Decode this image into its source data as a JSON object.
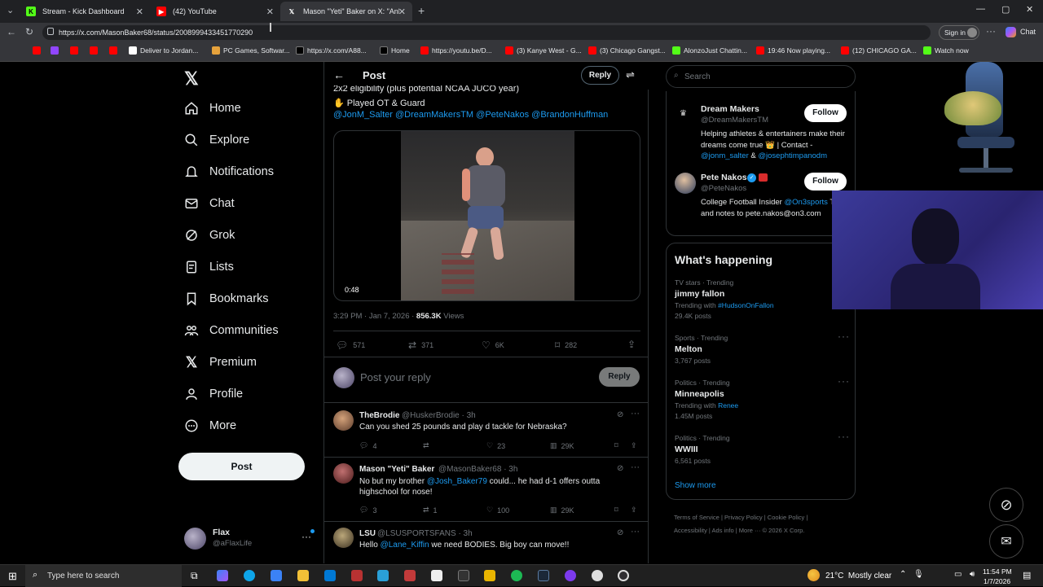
{
  "browser": {
    "tabs": [
      {
        "label": "Stream - Kick Dashboard",
        "fav": "K"
      },
      {
        "label": "(42) YouTube",
        "fav": "▶"
      },
      {
        "label": "Mason \"Yeti\" Baker on X: \"Ankle b",
        "fav": "X"
      }
    ],
    "url": "https://x.com/MasonBaker68/status/2008999433451770290",
    "sign_in": "Sign in",
    "chat": "Chat",
    "bookmarks": [
      "Deliver to Jordan...",
      "PC Games, Softwar...",
      "https://x.com/A88...",
      "Home",
      "https://youtu.be/D...",
      "(3) Kanye West - G...",
      "(3) Chicago Gangst...",
      "AlonzoJust Chattin...",
      "19:46 Now playing...",
      "(12) CHICAGO GA...",
      "Watch now"
    ]
  },
  "nav": {
    "items": [
      "Home",
      "Explore",
      "Notifications",
      "Chat",
      "Grok",
      "Lists",
      "Bookmarks",
      "Communities",
      "Premium",
      "Profile",
      "More"
    ],
    "post_button": "Post",
    "account_name": "Flax",
    "account_handle": "@aFlaxLife"
  },
  "post": {
    "header": "Post",
    "reply_button": "Reply",
    "line_partial": "2x2 eligibility (plus potential NCAA JUCO year)",
    "line_ot": "Played OT & Guard",
    "mentions": "@JonM_Salter @DreamMakersTM @PeteNakos @BrandonHuffman",
    "video_duration": "0:48",
    "timestamp": "3:29 PM · Jan 7, 2026 · ",
    "views_count": "856.3K",
    "views_label": " Views",
    "replies": "571",
    "reposts": "371",
    "likes": "6K",
    "bookmarks": "282",
    "reply_placeholder": "Post your reply",
    "reply_submit": "Reply"
  },
  "replies": [
    {
      "name": "TheBrodie",
      "handle": "@HuskerBrodie · 3h",
      "text": "Can you shed 25 pounds and play d tackle for Nebraska?",
      "c": "4",
      "r": "",
      "l": "23",
      "v": "29K"
    },
    {
      "name": "Mason \"Yeti\" Baker",
      "handle": "@MasonBaker68 · 3h",
      "text_a": "No but my brother ",
      "mention": "@Josh_Baker79",
      "text_b": " could... he had d-1 offers outta highschool for nose!",
      "c": "3",
      "r": "1",
      "l": "100",
      "v": "29K"
    },
    {
      "name": "LSU",
      "handle": "@LSUSPORTSFANS · 3h",
      "text_a": "Hello ",
      "mention": "@Lane_Kiffin",
      "text_b": " we need BODIES. Big boy can move!!"
    }
  ],
  "right": {
    "search_placeholder": "Search",
    "follow_label": "Follow",
    "accounts": [
      {
        "name": "Dream Makers",
        "handle": "@DreamMakersTM",
        "bio_a": "Helping athletes & entertainers make their dreams come true 👑 | Contact - ",
        "bio_m1": "@jonm_salter",
        "bio_b": " & ",
        "bio_m2": "@josephtimpanodm"
      },
      {
        "name": "Pete Nakos",
        "handle": "@PeteNakos",
        "bio_a": "College Football Insider ",
        "bio_m1": "@On3sports",
        "bio_b": " Tips and notes to pete.nakos@on3.com"
      }
    ],
    "whats_happening": "What's happening",
    "trends": [
      {
        "cat": "TV stars · Trending",
        "name": "jimmy fallon",
        "sub_a": "Trending with ",
        "sub_tag": "#HudsonOnFallon",
        "posts": "29.4K posts"
      },
      {
        "cat": "Sports · Trending",
        "name": "Melton",
        "posts": "3,767 posts"
      },
      {
        "cat": "Politics · Trending",
        "name": "Minneapolis",
        "sub_a": "Trending with ",
        "sub_tag": "Renee",
        "posts": "1.45M posts"
      },
      {
        "cat": "Politics · Trending",
        "name": "WWIII",
        "posts": "6,561 posts"
      }
    ],
    "show_more": "Show more",
    "footer": [
      "Terms of Service",
      "Privacy Policy",
      "Cookie Policy",
      "Accessibility",
      "Ads info",
      "More ···",
      "© 2026 X Corp."
    ]
  },
  "taskbar": {
    "search": "Type here to search",
    "weather": "21°C  Mostly clear",
    "time": "11:54 PM",
    "date": "1/7/2026"
  },
  "colors": {
    "accent": "#1d9bf0",
    "bg": "#000000",
    "border": "#2f3336"
  }
}
